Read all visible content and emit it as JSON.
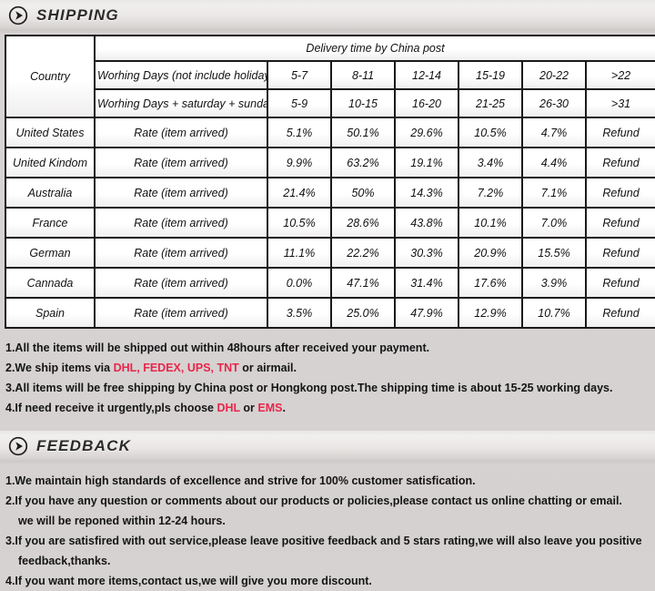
{
  "shipping": {
    "banner_title": "SHIPPING",
    "banner_icon": "play-circle-icon",
    "table": {
      "country_header": "Country",
      "delivery_header": "Delivery time by China post",
      "row_labels": [
        "Worhing Days (not include holiday)",
        "Worhing Days + saturday + sunday"
      ],
      "days_row_1": [
        "5-7",
        "8-11",
        "12-14",
        "15-19",
        "20-22",
        ">22"
      ],
      "days_row_2": [
        "5-9",
        "10-15",
        "16-20",
        "21-25",
        "26-30",
        ">31"
      ],
      "rate_label": "Rate (item arrived)",
      "rows": [
        {
          "country": "United States",
          "rate_label": "Rate (item arrived)",
          "values": [
            "5.1%",
            "50.1%",
            "29.6%",
            "10.5%",
            "4.7%",
            "Refund"
          ]
        },
        {
          "country": "United Kindom",
          "rate_label": "Rate (item arrived)",
          "values": [
            "9.9%",
            "63.2%",
            "19.1%",
            "3.4%",
            "4.4%",
            "Refund"
          ]
        },
        {
          "country": "Australia",
          "rate_label": "Rate (item arrived)",
          "values": [
            "21.4%",
            "50%",
            "14.3%",
            "7.2%",
            "7.1%",
            "Refund"
          ]
        },
        {
          "country": "France",
          "rate_label": "Rate (item arrived)",
          "values": [
            "10.5%",
            "28.6%",
            "43.8%",
            "10.1%",
            "7.0%",
            "Refund"
          ]
        },
        {
          "country": "German",
          "rate_label": "Rate (item arrived)",
          "values": [
            "11.1%",
            "22.2%",
            "30.3%",
            "20.9%",
            "15.5%",
            "Refund"
          ]
        },
        {
          "country": "Cannada",
          "rate_label": "Rate (item arrived)",
          "values": [
            "0.0%",
            "47.1%",
            "31.4%",
            "17.6%",
            "3.9%",
            "Refund"
          ]
        },
        {
          "country": "Spain",
          "rate_label": "Rate (item arrived)",
          "values": [
            "3.5%",
            "25.0%",
            "47.9%",
            "12.9%",
            "10.7%",
            "Refund"
          ]
        }
      ]
    },
    "notes": [
      {
        "parts": [
          {
            "text": "1.All the items will be shipped out within 48hours after received your payment.",
            "highlight": false
          }
        ]
      },
      {
        "parts": [
          {
            "text": "2.We ship items via ",
            "highlight": false
          },
          {
            "text": "DHL, FEDEX, UPS, TNT",
            "highlight": true
          },
          {
            "text": " or airmail.",
            "highlight": false
          }
        ]
      },
      {
        "parts": [
          {
            "text": "3.All items will be free shipping by China post or Hongkong post.The shipping time is about 15-25 working days.",
            "highlight": false
          }
        ]
      },
      {
        "parts": [
          {
            "text": "4.If need receive it urgently,pls choose ",
            "highlight": false
          },
          {
            "text": "DHL",
            "highlight": true
          },
          {
            "text": " or ",
            "highlight": false
          },
          {
            "text": "EMS",
            "highlight": true
          },
          {
            "text": ".",
            "highlight": false
          }
        ]
      }
    ]
  },
  "feedback": {
    "banner_title": "FEEDBACK",
    "banner_icon": "play-circle-icon",
    "notes": [
      {
        "indent": false,
        "parts": [
          {
            "text": "1.We maintain high standards of excellence and strive for 100% customer satisfication.",
            "highlight": false
          }
        ]
      },
      {
        "indent": false,
        "parts": [
          {
            "text": "2.If you have any question or comments about our products or policies,please contact us online chatting or email.",
            "highlight": false
          }
        ]
      },
      {
        "indent": true,
        "parts": [
          {
            "text": "we will be reponed within 12-24 hours.",
            "highlight": false
          }
        ]
      },
      {
        "indent": false,
        "parts": [
          {
            "text": "3.If you are satisfired with out service,please leave positive feedback and 5 stars rating,we will also leave you positive",
            "highlight": false
          }
        ]
      },
      {
        "indent": true,
        "parts": [
          {
            "text": "feedback,thanks.",
            "highlight": false
          }
        ]
      },
      {
        "indent": false,
        "parts": [
          {
            "text": "4.If you want more items,contact us,we will give you more discount.",
            "highlight": false
          }
        ]
      }
    ]
  },
  "colors": {
    "highlight": "#e8264a",
    "text": "#141414",
    "border": "#1a1a1a",
    "background": "#d5d1d1"
  }
}
